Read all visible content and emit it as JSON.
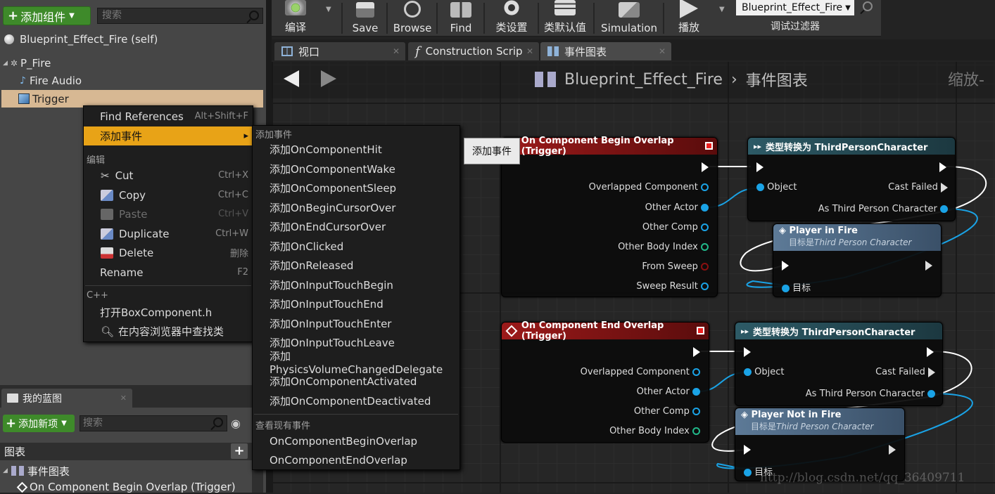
{
  "components": {
    "add_label": "添加组件",
    "search_placeholder": "搜索",
    "self_label": "Blueprint_Effect_Fire (self)",
    "items": [
      {
        "label": "P_Fire"
      },
      {
        "label": "Fire Audio"
      },
      {
        "label": "Trigger"
      }
    ]
  },
  "toolbar": {
    "buttons": [
      {
        "label": "编译",
        "icon": "compile-icon"
      },
      {
        "label": "Save",
        "icon": "save-icon"
      },
      {
        "label": "Browse",
        "icon": "browse-icon"
      },
      {
        "label": "Find",
        "icon": "find-icon"
      },
      {
        "label": "类设置",
        "icon": "class-settings-icon"
      },
      {
        "label": "类默认值",
        "icon": "class-defaults-icon"
      },
      {
        "label": "Simulation",
        "icon": "simulation-icon"
      },
      {
        "label": "播放",
        "icon": "play-icon"
      }
    ],
    "debug_selected": "Blueprint_Effect_Fire",
    "debug_label": "调试过滤器"
  },
  "tabs": [
    {
      "label": "视口"
    },
    {
      "label": "Construction Scrip"
    },
    {
      "label": "事件图表"
    }
  ],
  "graph": {
    "breadcrumb_blueprint": "Blueprint_Effect_Fire",
    "breadcrumb_graph": "事件图表",
    "zoom": "缩放-"
  },
  "context_menu": {
    "find_refs": {
      "label": "Find References",
      "shortcut": "Alt+Shift+F"
    },
    "add_event": "添加事件",
    "edit_header": "编辑",
    "edit_items": [
      {
        "label": "Cut",
        "shortcut": "Ctrl+X"
      },
      {
        "label": "Copy",
        "shortcut": "Ctrl+C"
      },
      {
        "label": "Paste",
        "shortcut": "Ctrl+V"
      },
      {
        "label": "Duplicate",
        "shortcut": "Ctrl+W"
      },
      {
        "label": "Delete",
        "shortcut": "删除"
      },
      {
        "label": "Rename",
        "shortcut": "F2"
      }
    ],
    "cpp_header": "C++",
    "open_header_file": "打开BoxComponent.h",
    "find_in_browser": "在内容浏览器中查找类"
  },
  "submenu": {
    "header": "添加事件",
    "items": [
      "添加OnComponentHit",
      "添加OnComponentWake",
      "添加OnComponentSleep",
      "添加OnBeginCursorOver",
      "添加OnEndCursorOver",
      "添加OnClicked",
      "添加OnReleased",
      "添加OnInputTouchBegin",
      "添加OnInputTouchEnd",
      "添加OnInputTouchEnter",
      "添加OnInputTouchLeave",
      "添加PhysicsVolumeChangedDelegate",
      "添加OnComponentActivated",
      "添加OnComponentDeactivated"
    ],
    "existing_header": "查看现有事件",
    "existing_items": [
      "OnComponentBeginOverlap",
      "OnComponentEndOverlap"
    ]
  },
  "tooltip": "添加事件",
  "nodes": {
    "begin_overlap": {
      "title": "On Component Begin Overlap (Trigger)",
      "pins": [
        "Overlapped Component",
        "Other Actor",
        "Other Comp",
        "Other Body Index",
        "From Sweep",
        "Sweep Result"
      ]
    },
    "cast1": {
      "title": "类型转换为 ThirdPersonCharacter",
      "object": "Object",
      "cast_failed": "Cast Failed",
      "as_out": "As Third Person Character"
    },
    "player_in_fire": {
      "title": "Player in Fire",
      "subtitle_prefix": "目标是",
      "subtitle_target": "Third Person Character",
      "target": "目标"
    },
    "end_overlap": {
      "title": "On Component End Overlap (Trigger)",
      "pins": [
        "Overlapped Component",
        "Other Actor",
        "Other Comp",
        "Other Body Index"
      ]
    },
    "cast2": {
      "title": "类型转换为 ThirdPersonCharacter",
      "object": "Object",
      "cast_failed": "Cast Failed",
      "as_out": "As Third Person Character"
    },
    "player_not_in_fire": {
      "title": "Player Not in Fire",
      "subtitle_prefix": "目标是",
      "subtitle_target": "Third Person Character",
      "target": "目标"
    }
  },
  "my_blueprint": {
    "tab_label": "我的蓝图",
    "add_new": "添加新项",
    "search_placeholder": "搜索",
    "graphs_header": "图表",
    "event_graph": "事件图表",
    "begin_overlap_event": "On Component Begin Overlap (Trigger)"
  },
  "watermark": "http://blog.csdn.net/qq_36409711",
  "colors": {
    "accent_orange": "#e8a317",
    "compile_green": "#3e8a2a",
    "selected_row": "#d7b893",
    "pin_blue": "#1aa3e6"
  }
}
